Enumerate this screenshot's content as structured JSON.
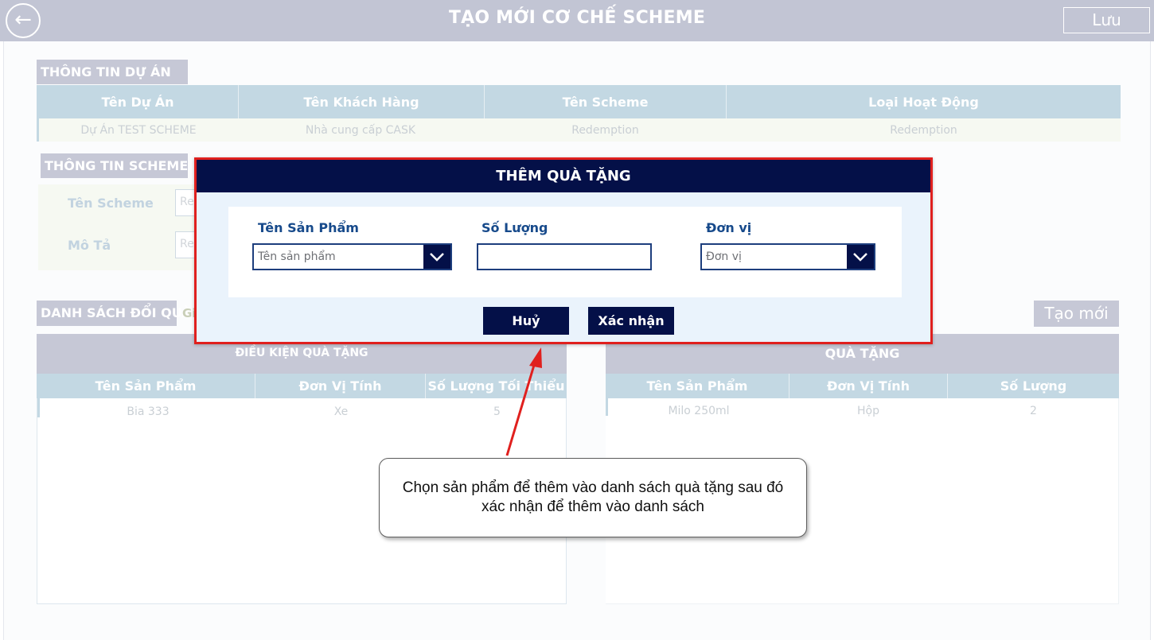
{
  "header": {
    "title": "TẠO MỚI CƠ CHẾ SCHEME",
    "back_icon": "arrow-left-icon",
    "save_label": "Lưu"
  },
  "project_info": {
    "section_label": "THÔNG TIN DỰ ÁN",
    "columns": [
      "Tên Dự Án",
      "Tên Khách Hàng",
      "Tên Scheme",
      "Loại Hoạt Động"
    ],
    "row": [
      "Dự Án TEST SCHEME",
      "Nhà cung cấp CASK",
      "Redemption",
      "Redemption"
    ]
  },
  "scheme_info": {
    "section_label": "THÔNG TIN SCHEME",
    "name_label": "Tên Scheme",
    "name_value": "Re",
    "desc_label": "Mô Tả",
    "desc_value": "Re"
  },
  "gift_list": {
    "section_label": "DANH SÁCH ĐỔI QUÀ",
    "extra_label": "Gi",
    "create_label": "Tạo mới",
    "condition": {
      "title": "ĐIỀU KIỆN QUÀ TẶNG",
      "columns": [
        "Tên Sản Phẩm",
        "Đơn Vị Tính",
        "Số Lượng Tối Thiểu"
      ],
      "rows": [
        [
          "Bia 333",
          "Xe",
          "5"
        ]
      ]
    },
    "gift": {
      "title": "QUÀ TẶNG",
      "columns": [
        "Tên Sản Phẩm",
        "Đơn Vị Tính",
        "Số Lượng"
      ],
      "rows": [
        [
          "Milo 250ml",
          "Hộp",
          "2"
        ]
      ]
    }
  },
  "modal": {
    "title": "THÊM QUÀ TẶNG",
    "product_label": "Tên Sản Phẩm",
    "product_placeholder": "Tên sản phẩm",
    "quantity_label": "Số Lượng",
    "quantity_value": "",
    "unit_label": "Đơn vị",
    "unit_placeholder": "Đơn vị",
    "cancel_label": "Huỷ",
    "confirm_label": "Xác nhận"
  },
  "callout": {
    "text": "Chọn sản phẩm để thêm vào danh sách quà tặng sau đó xác nhận để thêm vào danh sách"
  },
  "colors": {
    "header_bg": "#c2c5d4",
    "table_header": "#c3d8e3",
    "modal_header": "#041048",
    "modal_border": "#e0201e",
    "arrow": "#e0201e"
  }
}
